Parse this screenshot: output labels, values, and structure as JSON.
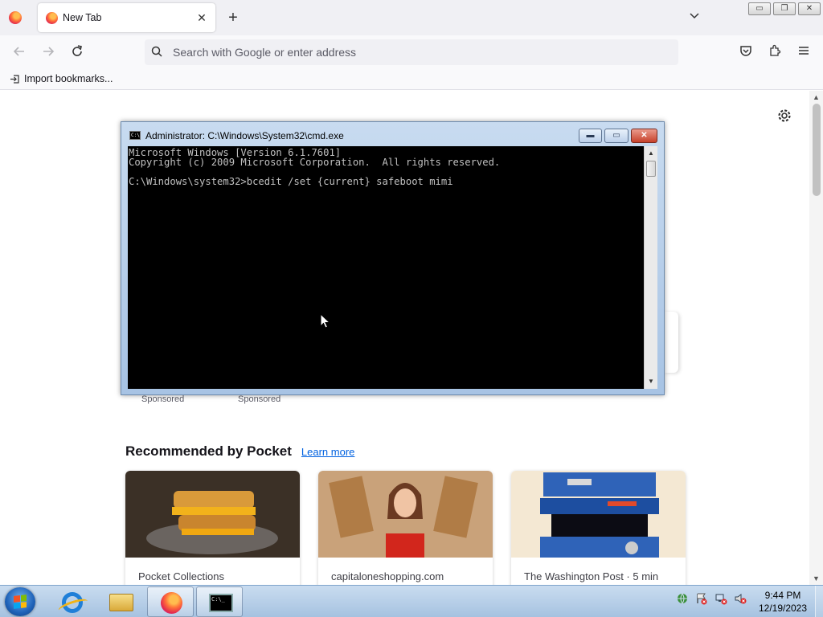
{
  "browser": {
    "tab_title": "New Tab",
    "tab_close": "✕",
    "new_tab": "+",
    "tab_list": "⌵",
    "address_placeholder": "Search with Google or enter address",
    "bookmark_import": "Import bookmarks...",
    "window_controls": [
      "▭",
      "❐",
      "✕"
    ]
  },
  "content": {
    "sponsored": [
      "Sponsored",
      "Sponsored"
    ],
    "pocket_title": "Recommended by Pocket",
    "pocket_link": "Learn more",
    "cards": [
      {
        "source": "Pocket Collections"
      },
      {
        "source": "capitaloneshopping.com"
      },
      {
        "source": "The Washington Post · 5 min"
      }
    ]
  },
  "cmd": {
    "title": "Administrator: C:\\Windows\\System32\\cmd.exe",
    "icon_text": "C:\\",
    "lines": "Microsoft Windows [Version 6.1.7601]\nCopyright (c) 2009 Microsoft Corporation.  All rights reserved.\n\nC:\\Windows\\system32>bcedit /set {current} safeboot mimi",
    "controls": [
      "▬",
      "▭",
      "✕"
    ]
  },
  "taskbar": {
    "time": "9:44 PM",
    "date": "12/19/2023",
    "cmd_icon_text": "C:\\_"
  },
  "colors": {
    "accent_link": "#0061e0",
    "cmd_bg": "#000000",
    "cmd_text": "#c0c0c0"
  }
}
